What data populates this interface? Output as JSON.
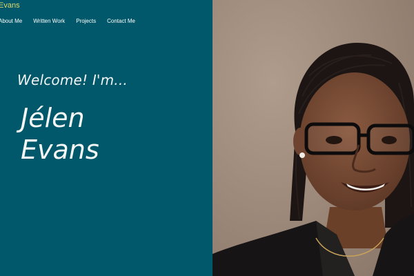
{
  "header": {
    "site_title": "Evans",
    "nav": [
      {
        "label": "About Me"
      },
      {
        "label": "Written Work"
      },
      {
        "label": "Projects"
      },
      {
        "label": "Contact Me"
      }
    ]
  },
  "hero": {
    "welcome": "Welcome! I'm...",
    "first_name": "Jélen",
    "last_name": "Evans"
  },
  "colors": {
    "panel": "#00586a",
    "title_accent": "#e3d96a"
  }
}
